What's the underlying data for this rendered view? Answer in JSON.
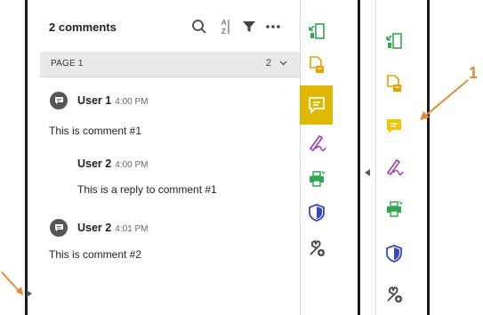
{
  "comments_panel": {
    "title": "2 comments",
    "page_label": "PAGE 1",
    "page_count": "2",
    "threads": [
      {
        "author": "User 1",
        "time": "4:00 PM",
        "text": "This is comment #1",
        "reply": {
          "author": "User 2",
          "time": "4:00 PM",
          "text": "This is a reply to comment #1"
        }
      },
      {
        "author": "User 2",
        "time": "4:01 PM",
        "text": "This is comment #2"
      }
    ]
  },
  "toolbar": {
    "tools": [
      "export-pdf-icon",
      "create-pdf-icon",
      "comment-icon",
      "fill-sign-icon",
      "print-production-icon",
      "protect-icon",
      "more-tools-icon"
    ],
    "active_tool": "comment-icon"
  },
  "callout": {
    "label": "1"
  },
  "colors": {
    "accent": "#e0b800",
    "comment_yellow": "#f2c500",
    "export_green": "#2fa84f",
    "create_yellow": "#e3a400",
    "sign_purple": "#9b3fb8",
    "protect_blue": "#3c45c4",
    "callout_orange": "#e58a33"
  }
}
